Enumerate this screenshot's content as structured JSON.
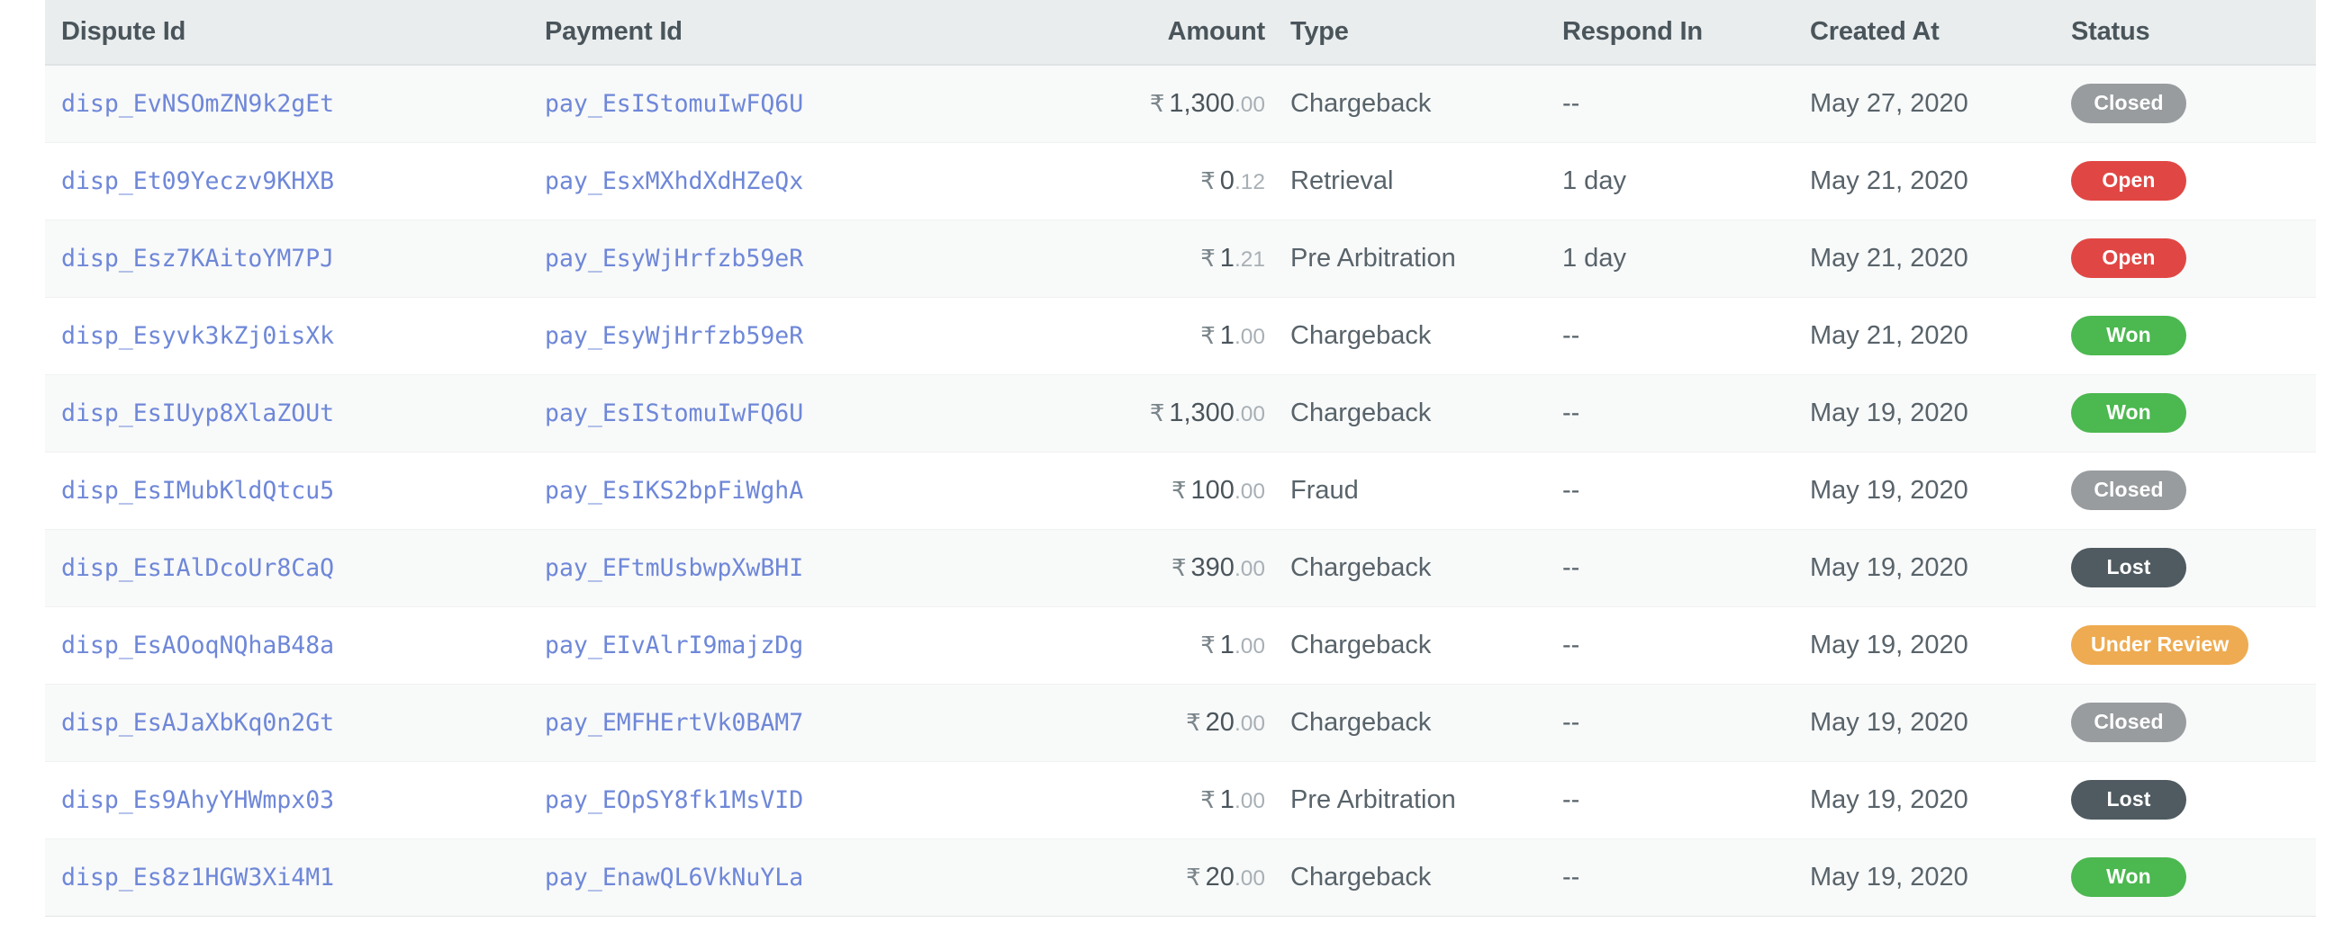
{
  "table": {
    "columns": [
      {
        "key": "dispute_id",
        "label": "Dispute Id"
      },
      {
        "key": "payment_id",
        "label": "Payment Id"
      },
      {
        "key": "amount",
        "label": "Amount"
      },
      {
        "key": "type",
        "label": "Type"
      },
      {
        "key": "respond_in",
        "label": "Respond In"
      },
      {
        "key": "created_at",
        "label": "Created At"
      },
      {
        "key": "status",
        "label": "Status"
      }
    ],
    "currency_symbol": "₹",
    "status_colors": {
      "Closed": "#989c9e",
      "Open": "#e04744",
      "Won": "#4cb850",
      "Lost": "#4f5b61",
      "Under Review": "#eeab51"
    },
    "link_color": "#6e87d8",
    "header_background": "#e9edee",
    "row_alt_background": "#f8f9f9",
    "rows": [
      {
        "dispute_id": "disp_EvNSOmZN9k2gEt",
        "payment_id": "pay_EsIStomuIwFQ6U",
        "amount_major": "1,300",
        "amount_minor": ".00",
        "amount_value": 1300.0,
        "type": "Chargeback",
        "respond_in": "--",
        "created_at": "May 27, 2020",
        "status": "Closed"
      },
      {
        "dispute_id": "disp_Et09Yeczv9KHXB",
        "payment_id": "pay_EsxMXhdXdHZeQx",
        "amount_major": "0",
        "amount_minor": ".12",
        "amount_value": 0.12,
        "type": "Retrieval",
        "respond_in": "1 day",
        "created_at": "May 21, 2020",
        "status": "Open"
      },
      {
        "dispute_id": "disp_Esz7KAitoYM7PJ",
        "payment_id": "pay_EsyWjHrfzb59eR",
        "amount_major": "1",
        "amount_minor": ".21",
        "amount_value": 1.21,
        "type": "Pre Arbitration",
        "respond_in": "1 day",
        "created_at": "May 21, 2020",
        "status": "Open"
      },
      {
        "dispute_id": "disp_Esyvk3kZj0isXk",
        "payment_id": "pay_EsyWjHrfzb59eR",
        "amount_major": "1",
        "amount_minor": ".00",
        "amount_value": 1.0,
        "type": "Chargeback",
        "respond_in": "--",
        "created_at": "May 21, 2020",
        "status": "Won"
      },
      {
        "dispute_id": "disp_EsIUyp8XlaZOUt",
        "payment_id": "pay_EsIStomuIwFQ6U",
        "amount_major": "1,300",
        "amount_minor": ".00",
        "amount_value": 1300.0,
        "type": "Chargeback",
        "respond_in": "--",
        "created_at": "May 19, 2020",
        "status": "Won"
      },
      {
        "dispute_id": "disp_EsIMubKldQtcu5",
        "payment_id": "pay_EsIKS2bpFiWghA",
        "amount_major": "100",
        "amount_minor": ".00",
        "amount_value": 100.0,
        "type": "Fraud",
        "respond_in": "--",
        "created_at": "May 19, 2020",
        "status": "Closed"
      },
      {
        "dispute_id": "disp_EsIAlDcoUr8CaQ",
        "payment_id": "pay_EFtmUsbwpXwBHI",
        "amount_major": "390",
        "amount_minor": ".00",
        "amount_value": 390.0,
        "type": "Chargeback",
        "respond_in": "--",
        "created_at": "May 19, 2020",
        "status": "Lost"
      },
      {
        "dispute_id": "disp_EsAOoqNQhaB48a",
        "payment_id": "pay_EIvAlrI9majzDg",
        "amount_major": "1",
        "amount_minor": ".00",
        "amount_value": 1.0,
        "type": "Chargeback",
        "respond_in": "--",
        "created_at": "May 19, 2020",
        "status": "Under Review"
      },
      {
        "dispute_id": "disp_EsAJaXbKq0n2Gt",
        "payment_id": "pay_EMFHErtVk0BAM7",
        "amount_major": "20",
        "amount_minor": ".00",
        "amount_value": 20.0,
        "type": "Chargeback",
        "respond_in": "--",
        "created_at": "May 19, 2020",
        "status": "Closed"
      },
      {
        "dispute_id": "disp_Es9AhyYHWmpx03",
        "payment_id": "pay_EOpSY8fk1MsVID",
        "amount_major": "1",
        "amount_minor": ".00",
        "amount_value": 1.0,
        "type": "Pre Arbitration",
        "respond_in": "--",
        "created_at": "May 19, 2020",
        "status": "Lost"
      },
      {
        "dispute_id": "disp_Es8z1HGW3Xi4M1",
        "payment_id": "pay_EnawQL6VkNuYLa",
        "amount_major": "20",
        "amount_minor": ".00",
        "amount_value": 20.0,
        "type": "Chargeback",
        "respond_in": "--",
        "created_at": "May 19, 2020",
        "status": "Won"
      }
    ]
  }
}
